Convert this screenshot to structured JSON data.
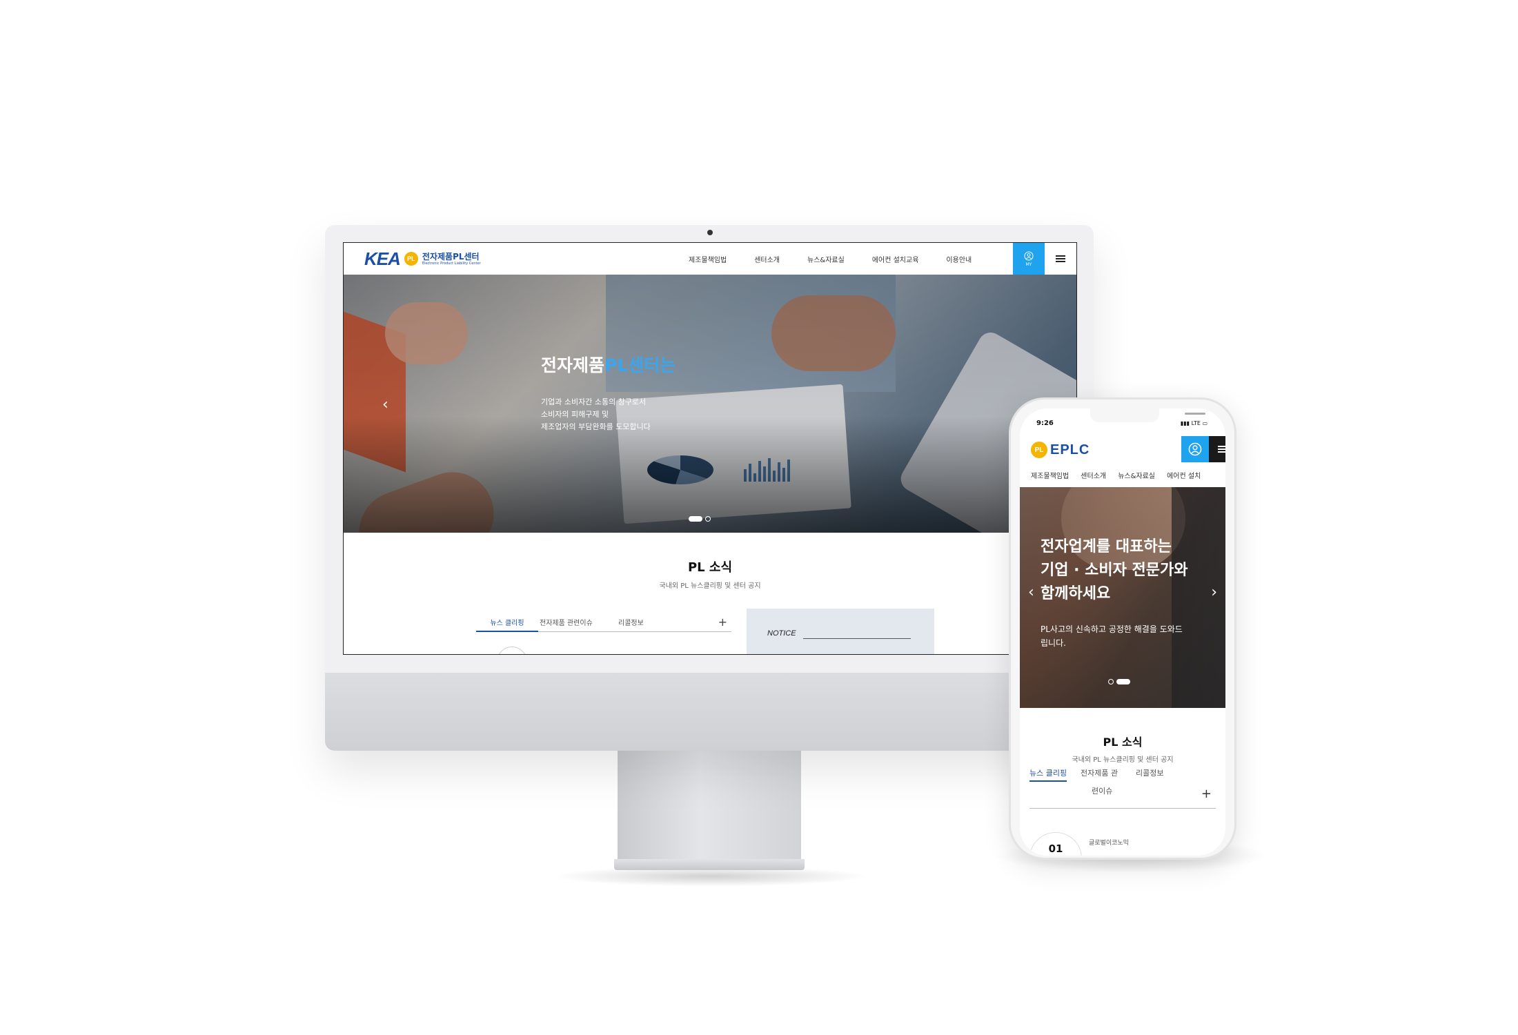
{
  "desktop": {
    "logo": {
      "brand": "KEA",
      "badge": "PL",
      "name": "전자제품PL센터",
      "subtitle": "Electronic Product Liability Center"
    },
    "nav": [
      "제조물책임법",
      "센터소개",
      "뉴스&자료실",
      "에어컨 설치교육",
      "이용안내"
    ],
    "my_label": "MY",
    "hero": {
      "title_prefix": "전자제품",
      "title_highlight": "PL센터는",
      "desc_lines": [
        "기업과 소비자간 소통의 창구로서",
        "소비자의 피해구제 및",
        "제조업자의 부담완화를 도모합니다"
      ],
      "slides_total": 2,
      "slide_active": 1
    },
    "section": {
      "title": "PL 소식",
      "subtitle": "국내외 PL 뉴스클리핑 및 센터 공지",
      "tabs": [
        "뉴스 클리핑",
        "전자제품 관련이슈",
        "리콜정보"
      ],
      "active_tab": 0,
      "plus": "+",
      "notice_label": "NOTICE"
    }
  },
  "mobile": {
    "status": {
      "time": "9:26",
      "network": "LTE"
    },
    "logo": {
      "badge": "PL",
      "name": "EPLC"
    },
    "nav": [
      "제조물책임법",
      "센터소개",
      "뉴스&자료실",
      "에어컨 설치"
    ],
    "hero": {
      "title_lines": [
        "전자업계를 대표하는",
        "기업 · 소비자 전문가와",
        "함께하세요"
      ],
      "desc_lines": [
        "PL사고의 신속하고 공정한 해결을 도와드",
        "립니다."
      ],
      "slides_total": 2,
      "slide_active": 2
    },
    "section": {
      "title": "PL 소식",
      "subtitle": "국내외 PL 뉴스클리핑 및 센터 공지",
      "tabs": [
        "뉴스 클리핑",
        "전자제품 관",
        "리콜정보"
      ],
      "tab_wrap": "련이슈",
      "active_tab": 0,
      "plus": "+",
      "item_number": "01",
      "item_meta": "글로벌이코노믹"
    }
  },
  "colors": {
    "accent": "#1fa3ee",
    "brand": "#1b4fa3",
    "badge": "#f4b400"
  }
}
